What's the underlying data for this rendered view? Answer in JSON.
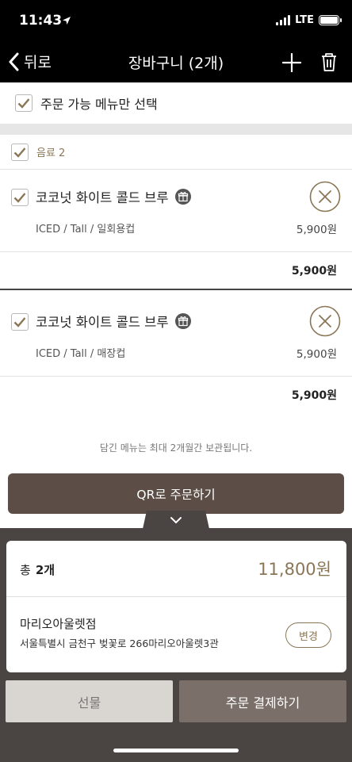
{
  "status_bar": {
    "time": "11:43",
    "network": "LTE",
    "icons": [
      "location-arrow-icon",
      "signal-icon",
      "battery-icon"
    ]
  },
  "header": {
    "back_label": "뒤로",
    "title": "장바구니 (2개)",
    "icons": [
      "chevron-left-icon",
      "plus-icon",
      "trash-icon"
    ]
  },
  "select_available": {
    "label": "주문 가능 메뉴만 선택",
    "checked": true
  },
  "category": {
    "label": "음료 2",
    "checked": true
  },
  "items": [
    {
      "name": "코코넛 화이트 콜드 브루",
      "options": "ICED / Tall / 일회용컵",
      "price": "5,900원",
      "total": "5,900원",
      "checked": true
    },
    {
      "name": "코코넛 화이트 콜드 브루",
      "options": "ICED / Tall / 매장컵",
      "price": "5,900원",
      "total": "5,900원",
      "checked": true
    }
  ],
  "notice": "담긴 메뉴는 최대 2개월간 보관됩니다.",
  "qr_order_label": "QR로 주문하기",
  "summary": {
    "total_label": "총",
    "total_count": "2개",
    "total_price": "11,800원"
  },
  "store": {
    "name": "마리오아울렛점",
    "address": "서울특별시 금천구 벚꽃로 266마리오아울렛3관",
    "change_label": "변경"
  },
  "actions": {
    "gift_label": "선물",
    "pay_label": "주문 결제하기"
  },
  "colors": {
    "accent": "#8a7656",
    "dark_button": "#5c4e47",
    "sheet_bg": "#4a4542",
    "pay_button": "#7b6f69",
    "gift_button": "#d9d5d0"
  }
}
